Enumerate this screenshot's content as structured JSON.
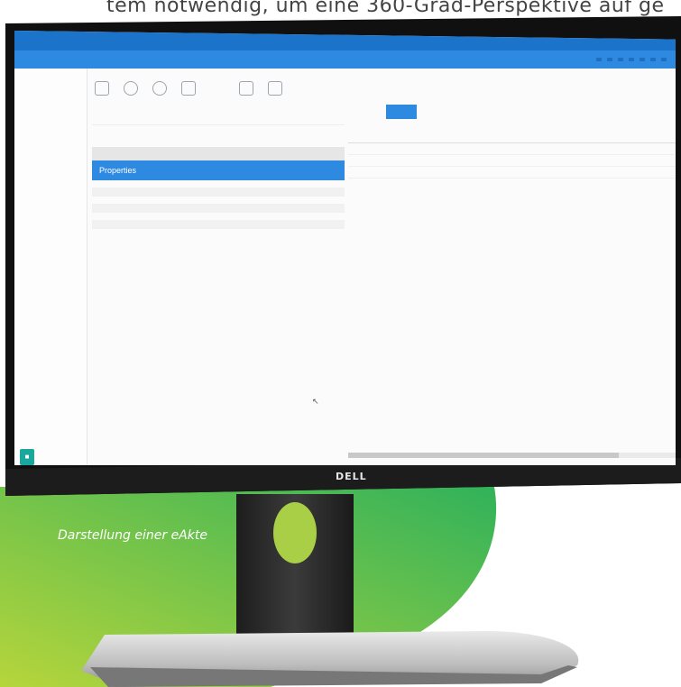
{
  "headline": "tem notwendig, um eine 360-Grad-Perspektive auf ge",
  "caption": "Darstellung einer eAkte",
  "brand_logo": "DELL",
  "colors": {
    "accent_blue": "#2d8ae0",
    "blob_green_start": "#b6d53b",
    "blob_green_end": "#31b25a"
  },
  "screen": {
    "app_title": "",
    "top_nav": [
      "",
      "",
      "",
      "",
      "",
      "",
      ""
    ],
    "sidebar": {
      "breadcrumb": "",
      "items": [
        "",
        "",
        "",
        "",
        "",
        ""
      ]
    },
    "detail_title": "",
    "gray_box_title": "",
    "properties_header": "Properties"
  }
}
